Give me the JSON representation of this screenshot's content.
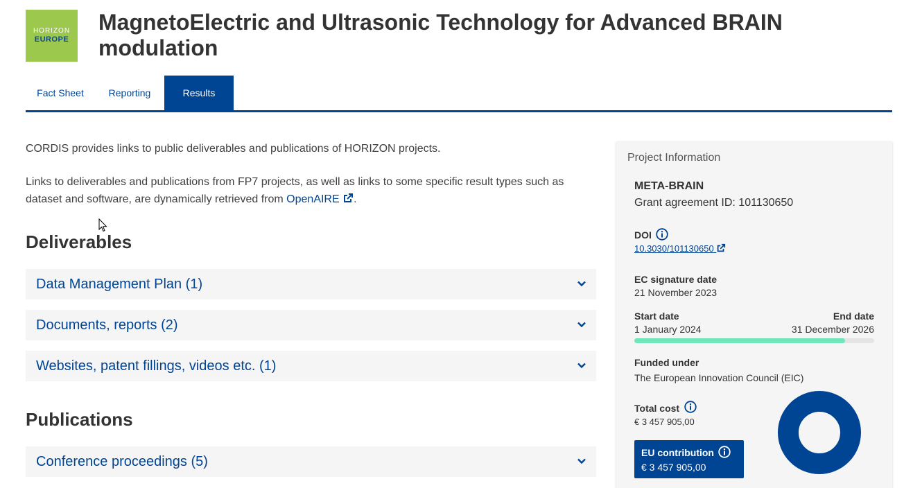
{
  "logo": {
    "line1": "HORIZON",
    "line2": "EUROPE"
  },
  "page_title": "MagnetoElectric and Ultrasonic Technology for Advanced BRAIN modulation",
  "tabs": [
    {
      "label": "Fact Sheet",
      "active": false
    },
    {
      "label": "Reporting",
      "active": false
    },
    {
      "label": "Results",
      "active": true
    }
  ],
  "intro": {
    "p1": "CORDIS provides links to public deliverables and publications of HORIZON projects.",
    "p2_text": "Links to deliverables and publications from FP7 projects, as well as links to some specific result types such as dataset and software, are dynamically retrieved from ",
    "p2_link": "OpenAIRE",
    "p2_end": "."
  },
  "deliverables": {
    "title": "Deliverables",
    "items": [
      {
        "label": "Data Management Plan (1)"
      },
      {
        "label": "Documents, reports (2)"
      },
      {
        "label": "Websites, patent fillings, videos etc. (1)"
      }
    ]
  },
  "publications": {
    "title": "Publications",
    "items": [
      {
        "label": "Conference proceedings (5)"
      }
    ]
  },
  "project_info": {
    "title": "Project Information",
    "acronym": "META-BRAIN",
    "grant": "Grant agreement ID: 101130650",
    "doi_label": "DOI",
    "doi_value": "10.3030/101130650",
    "ec_sig_label": "EC signature date",
    "ec_sig_value": "21 November 2023",
    "start_label": "Start date",
    "start_value": "1 January 2024",
    "end_label": "End date",
    "end_value": "31 December 2026",
    "progress_fraction": 0.88,
    "funded_label": "Funded under",
    "funded_value": "The European Innovation Council (EIC)",
    "total_cost_label": "Total cost",
    "total_cost_value": "€ 3 457 905,00",
    "eu_contrib_label": "EU contribution",
    "eu_contrib_value": "€ 3 457 905,00",
    "eu_share_fraction": 1.0
  },
  "colors": {
    "brand_blue": "#004494",
    "logo_green": "#9cc94d",
    "progress_green": "#6ee6b9",
    "panel_bg": "#f5f5f5"
  },
  "icons": [
    "external-link-icon",
    "info-icon",
    "chevron-down-icon",
    "mouse-cursor-icon"
  ]
}
